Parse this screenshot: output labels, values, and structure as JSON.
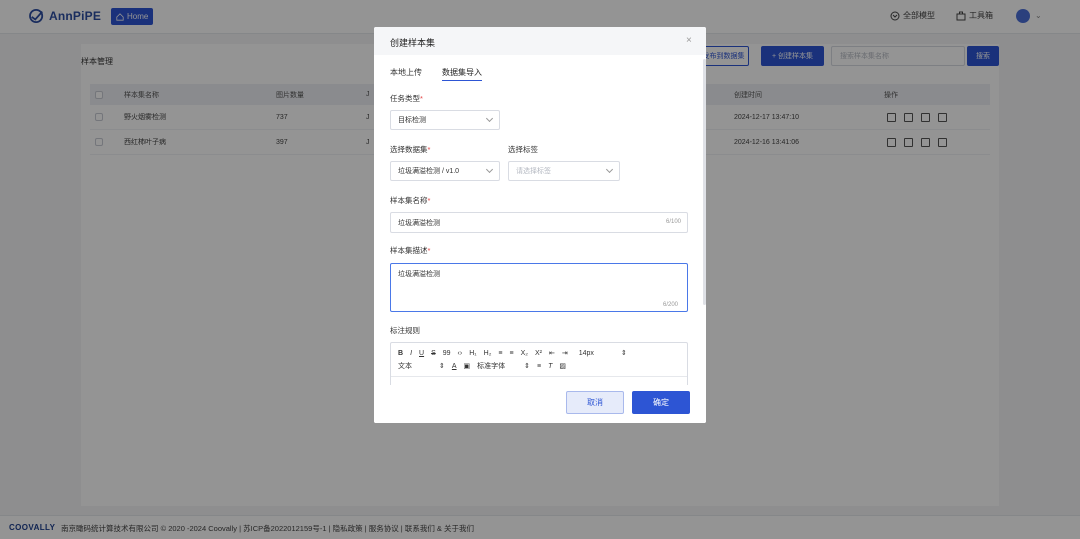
{
  "header": {
    "logo_text": "AnnPiPE",
    "home_label": "Home",
    "all_models_label": "全部模型",
    "toolbox_label": "工具箱"
  },
  "page": {
    "breadcrumb": "样本管理",
    "toolbar": {
      "publish_label": "发布到数据集",
      "create_label": "+ 创建样本集",
      "search_placeholder": "搜索样本集名称",
      "search_label": "搜索"
    },
    "table": {
      "columns": [
        "样本集名称",
        "图片数量",
        "J",
        "创建时间",
        "操作"
      ],
      "rows": [
        {
          "name": "野火烟雾检测",
          "count": "737",
          "col3": "J",
          "created": "2024-12-17 13:47:10"
        },
        {
          "name": "西红柿叶子病",
          "count": "397",
          "col3": "J",
          "created": "2024-12-16 13:41:06"
        }
      ]
    }
  },
  "footer": {
    "brand": "COOVALLY",
    "text": "南京瞰码统计算技术有限公司 © 2020 -2024 Coovally | 苏ICP备2022012159号-1 | 隐私政策 | 服务协议 | 联系我们 & 关于我们"
  },
  "modal": {
    "title": "创建样本集",
    "close": "×",
    "tabs": [
      "本地上传",
      "数据集导入"
    ],
    "task_type": {
      "label": "任务类型",
      "value": "目标检测"
    },
    "dataset": {
      "label": "选择数据集",
      "value": "垃圾满溢检测 / v1.0"
    },
    "tags": {
      "label": "选择标签",
      "placeholder": "请选择标签"
    },
    "name": {
      "label": "样本集名称",
      "value": "垃圾满溢检测",
      "counter": "6/100"
    },
    "description": {
      "label": "样本集描述",
      "value": "垃圾满溢检测",
      "counter": "6/200"
    },
    "rules": {
      "label": "标注规则",
      "toolbar_row1": [
        "B",
        "I",
        "U",
        "S",
        "99",
        "‹›",
        "H₁",
        "H₂",
        "≡",
        "≡",
        "X₂",
        "X²",
        "⇤",
        "⇥"
      ],
      "font_size": "14px",
      "text_style": "文本",
      "font_family": "标准字体"
    },
    "cancel_label": "取消",
    "ok_label": "确定",
    "required_mark": "*"
  },
  "colors": {
    "primary": "#2d55d4",
    "required": "#e54545"
  }
}
